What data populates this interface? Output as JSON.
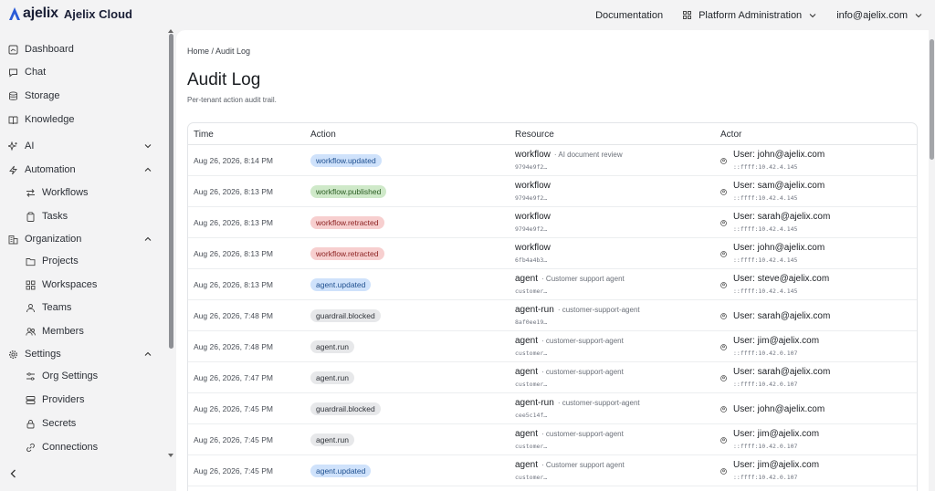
{
  "header": {
    "logo_word": "ajelix",
    "app_name": "Ajelix Cloud",
    "documentation": "Documentation",
    "platform_admin": "Platform Administration",
    "user_email": "info@ajelix.com"
  },
  "sidebar": {
    "items": [
      {
        "label": "Dashboard",
        "icon": "dashboard-icon"
      },
      {
        "label": "Chat",
        "icon": "chat-icon"
      },
      {
        "label": "Storage",
        "icon": "database-icon"
      },
      {
        "label": "Knowledge",
        "icon": "book-icon"
      },
      {
        "label": "AI",
        "icon": "sparkle-icon",
        "caret": "down"
      },
      {
        "label": "Automation",
        "icon": "bolt-icon",
        "caret": "up"
      },
      {
        "label": "Workflows",
        "icon": "arrows-icon",
        "sub": true
      },
      {
        "label": "Tasks",
        "icon": "clipboard-icon",
        "sub": true
      },
      {
        "label": "Organization",
        "icon": "building-icon",
        "caret": "up"
      },
      {
        "label": "Projects",
        "icon": "folder-icon",
        "sub": true
      },
      {
        "label": "Workspaces",
        "icon": "grid-icon",
        "sub": true
      },
      {
        "label": "Teams",
        "icon": "users-icon",
        "sub": true
      },
      {
        "label": "Members",
        "icon": "members-icon",
        "sub": true
      },
      {
        "label": "Settings",
        "icon": "gear-icon",
        "caret": "up"
      },
      {
        "label": "Org Settings",
        "icon": "sliders-icon",
        "sub": true
      },
      {
        "label": "Providers",
        "icon": "server-icon",
        "sub": true
      },
      {
        "label": "Secrets",
        "icon": "lock-icon",
        "sub": true
      },
      {
        "label": "Connections",
        "icon": "link-icon",
        "sub": true
      }
    ]
  },
  "page": {
    "breadcrumb": "Home / Audit Log",
    "title": "Audit Log",
    "subtitle": "Per-tenant action audit trail."
  },
  "table": {
    "columns": [
      "Time",
      "Action",
      "Resource",
      "Actor"
    ],
    "rows": [
      {
        "time": "Aug 26, 2026, 8:14 PM",
        "action": "workflow.updated",
        "kind": "blue",
        "res": "workflow",
        "res_desc": "· AI document review",
        "res_id": "9794e9f2…",
        "actor": "User: john@ajelix.com",
        "ip": "::ffff:10.42.4.145"
      },
      {
        "time": "Aug 26, 2026, 8:13 PM",
        "action": "workflow.published",
        "kind": "green",
        "res": "workflow",
        "res_desc": "",
        "res_id": "9794e9f2…",
        "actor": "User: sam@ajelix.com",
        "ip": "::ffff:10.42.4.145"
      },
      {
        "time": "Aug 26, 2026, 8:13 PM",
        "action": "workflow.retracted",
        "kind": "red",
        "res": "workflow",
        "res_desc": "",
        "res_id": "9794e9f2…",
        "actor": "User: sarah@ajelix.com",
        "ip": "::ffff:10.42.4.145"
      },
      {
        "time": "Aug 26, 2026, 8:13 PM",
        "action": "workflow.retracted",
        "kind": "red",
        "res": "workflow",
        "res_desc": "",
        "res_id": "6fb4a4b3…",
        "actor": "User: john@ajelix.com",
        "ip": "::ffff:10.42.4.145"
      },
      {
        "time": "Aug 26, 2026, 8:13 PM",
        "action": "agent.updated",
        "kind": "blue",
        "res": "agent",
        "res_desc": "· Customer support agent",
        "res_id": "customer…",
        "actor": "User: steve@ajelix.com",
        "ip": "::ffff:10.42.4.145"
      },
      {
        "time": "Aug 26, 2026, 7:48 PM",
        "action": "guardrail.blocked",
        "kind": "gray",
        "res": "agent-run",
        "res_desc": "· customer-support-agent",
        "res_id": "8af0ee19…",
        "actor": "User: sarah@ajelix.com",
        "ip": ""
      },
      {
        "time": "Aug 26, 2026, 7:48 PM",
        "action": "agent.run",
        "kind": "gray",
        "res": "agent",
        "res_desc": "· customer-support-agent",
        "res_id": "customer…",
        "actor": "User: jim@ajelix.com",
        "ip": "::ffff:10.42.0.107"
      },
      {
        "time": "Aug 26, 2026, 7:47 PM",
        "action": "agent.run",
        "kind": "gray",
        "res": "agent",
        "res_desc": "· customer-support-agent",
        "res_id": "customer…",
        "actor": "User: sarah@ajelix.com",
        "ip": "::ffff:10.42.0.107"
      },
      {
        "time": "Aug 26, 2026, 7:45 PM",
        "action": "guardrail.blocked",
        "kind": "gray",
        "res": "agent-run",
        "res_desc": "· customer-support-agent",
        "res_id": "cee5c14f…",
        "actor": "User: john@ajelix.com",
        "ip": ""
      },
      {
        "time": "Aug 26, 2026, 7:45 PM",
        "action": "agent.run",
        "kind": "gray",
        "res": "agent",
        "res_desc": "· customer-support-agent",
        "res_id": "customer…",
        "actor": "User: jim@ajelix.com",
        "ip": "::ffff:10.42.0.107"
      },
      {
        "time": "Aug 26, 2026, 7:45 PM",
        "action": "agent.updated",
        "kind": "blue",
        "res": "agent",
        "res_desc": "· Customer support agent",
        "res_id": "customer…",
        "actor": "User: jim@ajelix.com",
        "ip": "::ffff:10.42.0.107"
      }
    ]
  },
  "colors": {
    "blue_bg": "#cfe2fb",
    "blue_fg": "#1e4f8f",
    "green_bg": "#cfe9c9",
    "green_fg": "#2b5d23",
    "red_bg": "#f7cfcf",
    "red_fg": "#8c2222",
    "gray_bg": "#e7e8ea",
    "gray_fg": "#30343a"
  }
}
